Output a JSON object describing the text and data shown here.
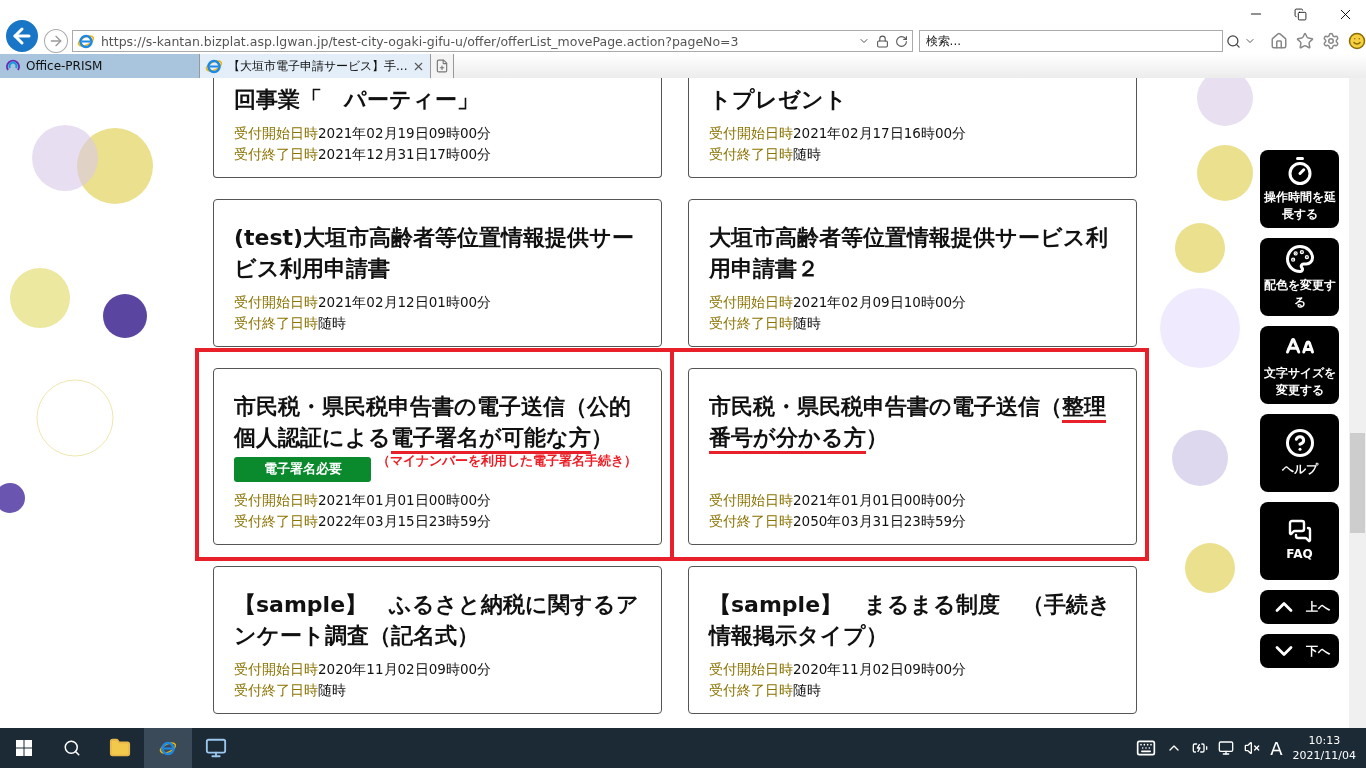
{
  "browser": {
    "address": "https://s-kantan.bizplat.asp.lgwan.jp/test-city-ogaki-gifu-u/offer/offerList_movePage.action?pageNo=3",
    "search_placeholder": "検索...",
    "tabs": [
      {
        "label": "Office-PRISM",
        "selected": false
      },
      {
        "label": "【大垣市電子申請サービス】手...",
        "selected": true
      }
    ]
  },
  "cards": [
    {
      "title_parts": [
        {
          "text": "回事業「　パーティー」",
          "underlined": false
        }
      ],
      "highlighted": false,
      "start_label": "受付開始日時",
      "start_value": "2021年02月19日09時00分",
      "end_label": "受付終了日時",
      "end_value": "2021年12月31日17時00分"
    },
    {
      "title_parts": [
        {
          "text": "トプレゼント",
          "underlined": false
        }
      ],
      "highlighted": false,
      "start_label": "受付開始日時",
      "start_value": "2021年02月17日16時00分",
      "end_label": "受付終了日時",
      "end_value": "随時"
    },
    {
      "title_parts": [
        {
          "text": "(test)大垣市高齢者等位置情報提供サービス利用申請書",
          "underlined": false
        }
      ],
      "highlighted": false,
      "start_label": "受付開始日時",
      "start_value": "2021年02月12日01時00分",
      "end_label": "受付終了日時",
      "end_value": "随時"
    },
    {
      "title_parts": [
        {
          "text": "大垣市高齢者等位置情報提供サービス利用申請書２",
          "underlined": false
        }
      ],
      "highlighted": false,
      "start_label": "受付開始日時",
      "start_value": "2021年02月09日10時00分",
      "end_label": "受付終了日時",
      "end_value": "随時"
    },
    {
      "title_parts": [
        {
          "text": "市民税・県民税申告書の電子送信（公的個人認証による",
          "underlined": false
        },
        {
          "text": "電子署名が可能な方",
          "underlined": true
        },
        {
          "text": "）",
          "underlined": false
        }
      ],
      "badge": "電子署名必要",
      "note": "（マイナンバーを利用した電子署名手続き）",
      "highlighted": true,
      "start_label": "受付開始日時",
      "start_value": "2021年01月01日00時00分",
      "end_label": "受付終了日時",
      "end_value": "2022年03月15日23時59分"
    },
    {
      "title_parts": [
        {
          "text": "市民税・県民税申告書の電子送信（",
          "underlined": false
        },
        {
          "text": "整理番号が分かる方",
          "underlined": true
        },
        {
          "text": "）",
          "underlined": false
        }
      ],
      "highlighted": true,
      "start_label": "受付開始日時",
      "start_value": "2021年01月01日00時00分",
      "end_label": "受付終了日時",
      "end_value": "2050年03月31日23時59分"
    },
    {
      "title_parts": [
        {
          "text": "【sample】　ふるさと納税に関するアンケート調査（記名式）",
          "underlined": false
        }
      ],
      "highlighted": false,
      "start_label": "受付開始日時",
      "start_value": "2020年11月02日09時00分",
      "end_label": "受付終了日時",
      "end_value": "随時"
    },
    {
      "title_parts": [
        {
          "text": "【sample】　まるまる制度　（手続き情報掲示タイプ）",
          "underlined": false
        }
      ],
      "highlighted": false,
      "start_label": "受付開始日時",
      "start_value": "2020年11月02日09時00分",
      "end_label": "受付終了日時",
      "end_value": "随時"
    }
  ],
  "sidebar_buttons": [
    {
      "kind": "timer",
      "label": "操作時間を延長する"
    },
    {
      "kind": "palette",
      "label": "配色を変更する"
    },
    {
      "kind": "font",
      "label": "文字サイズを変更する"
    },
    {
      "kind": "help",
      "label": "ヘルプ"
    },
    {
      "kind": "faq",
      "label": "FAQ"
    },
    {
      "kind": "up",
      "label": "上へ"
    },
    {
      "kind": "down",
      "label": "下へ"
    }
  ],
  "taskbar": {
    "ime": "A",
    "time": "10:13",
    "date": "2021/11/04"
  }
}
